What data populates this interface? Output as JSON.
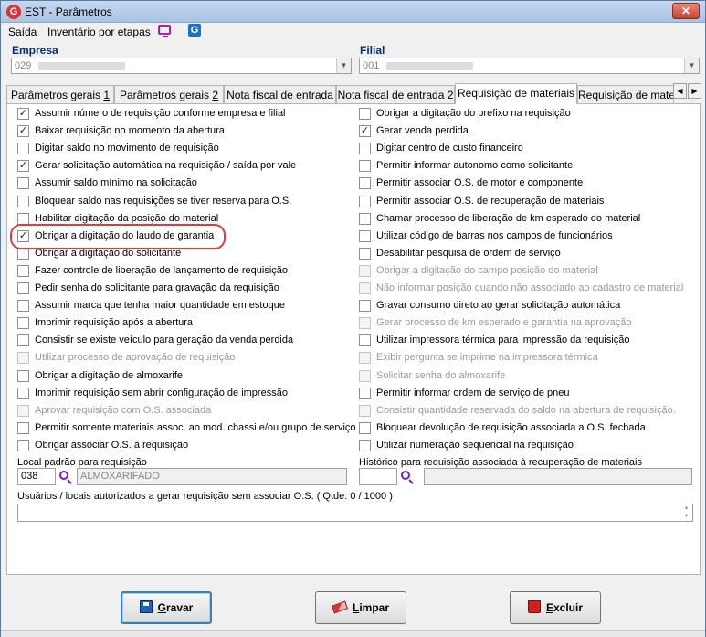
{
  "window": {
    "title": "EST - Parâmetros",
    "close": "✕"
  },
  "menu": {
    "items": [
      "Saída",
      "Inventário por etapas"
    ]
  },
  "empresa": {
    "label": "Empresa",
    "value": "029"
  },
  "filial": {
    "label": "Filial",
    "value": "001"
  },
  "tabs": [
    {
      "pre": "Parâmetros gerais ",
      "u": "1",
      "post": ""
    },
    {
      "pre": "Parâmetros gerais ",
      "u": "2",
      "post": ""
    },
    {
      "pre": "Nota fiscal de entrada",
      "u": "",
      "post": ""
    },
    {
      "pre": "Nota fiscal de entrada 2",
      "u": "",
      "post": ""
    },
    {
      "pre": "Requisição de materiais",
      "u": "",
      "post": ""
    },
    {
      "pre": "Requisição de materi",
      "u": "",
      "post": ""
    }
  ],
  "left_options": [
    {
      "label": "Assumir número de requisição conforme empresa e filial",
      "checked": true,
      "disabled": false
    },
    {
      "label": "Baixar requisição no momento da abertura",
      "checked": true,
      "disabled": false
    },
    {
      "label": "Digitar saldo no movimento de requisição",
      "checked": false,
      "disabled": false
    },
    {
      "label": "Gerar solicitação automática na requisição / saída por vale",
      "checked": true,
      "disabled": false
    },
    {
      "label": "Assumir saldo mínimo na solicitação",
      "checked": false,
      "disabled": false
    },
    {
      "label": "Bloquear saldo nas requisições se tiver reserva para O.S.",
      "checked": false,
      "disabled": false
    },
    {
      "label": "Habilitar digitação da posição do material",
      "checked": false,
      "disabled": false
    },
    {
      "label": "Obrigar a digitação do laudo de garantia",
      "checked": true,
      "disabled": false
    },
    {
      "label": "Obrigar a digitação do solicitante",
      "checked": false,
      "disabled": false
    },
    {
      "label": "Fazer controle de liberação de lançamento de requisição",
      "checked": false,
      "disabled": false
    },
    {
      "label": "Pedir senha do solicitante para gravação da requisição",
      "checked": false,
      "disabled": false
    },
    {
      "label": "Assumir marca que tenha maior quantidade em estoque",
      "checked": false,
      "disabled": false
    },
    {
      "label": "Imprimir requisição após a abertura",
      "checked": false,
      "disabled": false
    },
    {
      "label": "Consistir se existe veículo para geração da venda perdida",
      "checked": false,
      "disabled": false
    },
    {
      "label": "Utilizar processo de aprovação de requisição",
      "checked": false,
      "disabled": true
    },
    {
      "label": "Obrigar a digitação de almoxarife",
      "checked": false,
      "disabled": false
    },
    {
      "label": "Imprimir requisição sem abrir configuração de impressão",
      "checked": false,
      "disabled": false
    },
    {
      "label": "Aprovar requisição com O.S. associada",
      "checked": false,
      "disabled": true
    },
    {
      "label": "Permitir somente materiais assoc. ao mod. chassi e/ou grupo de serviço",
      "checked": false,
      "disabled": false
    },
    {
      "label": "Obrigar associar O.S. à requisição",
      "checked": false,
      "disabled": false
    }
  ],
  "right_options": [
    {
      "label": "Obrigar a digitação do prefixo na requisição",
      "checked": false,
      "disabled": false
    },
    {
      "label": "Gerar venda perdida",
      "checked": true,
      "disabled": false
    },
    {
      "label": "Digitar centro de custo financeiro",
      "checked": false,
      "disabled": false
    },
    {
      "label": "Permitir informar autonomo como solicitante",
      "checked": false,
      "disabled": false
    },
    {
      "label": "Permitir associar O.S. de motor e componente",
      "checked": false,
      "disabled": false
    },
    {
      "label": "Permitir associar O.S. de recuperação de materiais",
      "checked": false,
      "disabled": false
    },
    {
      "label": "Chamar processo de liberação de km esperado do material",
      "checked": false,
      "disabled": false
    },
    {
      "label": "Utilizar código de barras nos campos de funcionários",
      "checked": false,
      "disabled": false
    },
    {
      "label": "Desabilitar pesquisa de ordem de serviço",
      "checked": false,
      "disabled": false
    },
    {
      "label": "Obrigar a digitação do campo posição do material",
      "checked": false,
      "disabled": true
    },
    {
      "label": "Não informar posição quando não associado ao cadastro de material",
      "checked": false,
      "disabled": true
    },
    {
      "label": "Gravar consumo direto ao gerar solicitação automática",
      "checked": false,
      "disabled": false
    },
    {
      "label": "Gerar processo de km esperado e garantia na aprovação",
      "checked": false,
      "disabled": true
    },
    {
      "label": "Utilizar impressora térmica para impressão da requisição",
      "checked": false,
      "disabled": false
    },
    {
      "label": "Exibir pergunta se imprime na impressora térmica",
      "checked": false,
      "disabled": true
    },
    {
      "label": "Solicitar senha do almoxarife",
      "checked": false,
      "disabled": true
    },
    {
      "label": "Permitir informar ordem de serviço de pneu",
      "checked": false,
      "disabled": false
    },
    {
      "label": "Consistir quantidade reservada do saldo na abertura de requisição.",
      "checked": false,
      "disabled": true
    },
    {
      "label": "Bloquear devolução de requisição associada a O.S. fechada",
      "checked": false,
      "disabled": false
    },
    {
      "label": "Utilizar numeração sequencial na requisição",
      "checked": false,
      "disabled": false
    }
  ],
  "local_padrao": {
    "label": "Local padrão para requisição",
    "code": "038",
    "name": "ALMOXARIFADO"
  },
  "historico": {
    "label": "Histórico para requisição associada à recuperação de materiais",
    "code": "",
    "name": ""
  },
  "usuarios": {
    "label": "Usuários / locais autorizados a gerar requisição sem associar O.S.  ( Qtde: 0 / 1000 )",
    "value": ""
  },
  "buttons": {
    "save": {
      "u": "G",
      "rest": "ravar"
    },
    "clear": {
      "u": "L",
      "rest": "impar"
    },
    "delete": {
      "u": "E",
      "rest": "xcluir"
    }
  }
}
